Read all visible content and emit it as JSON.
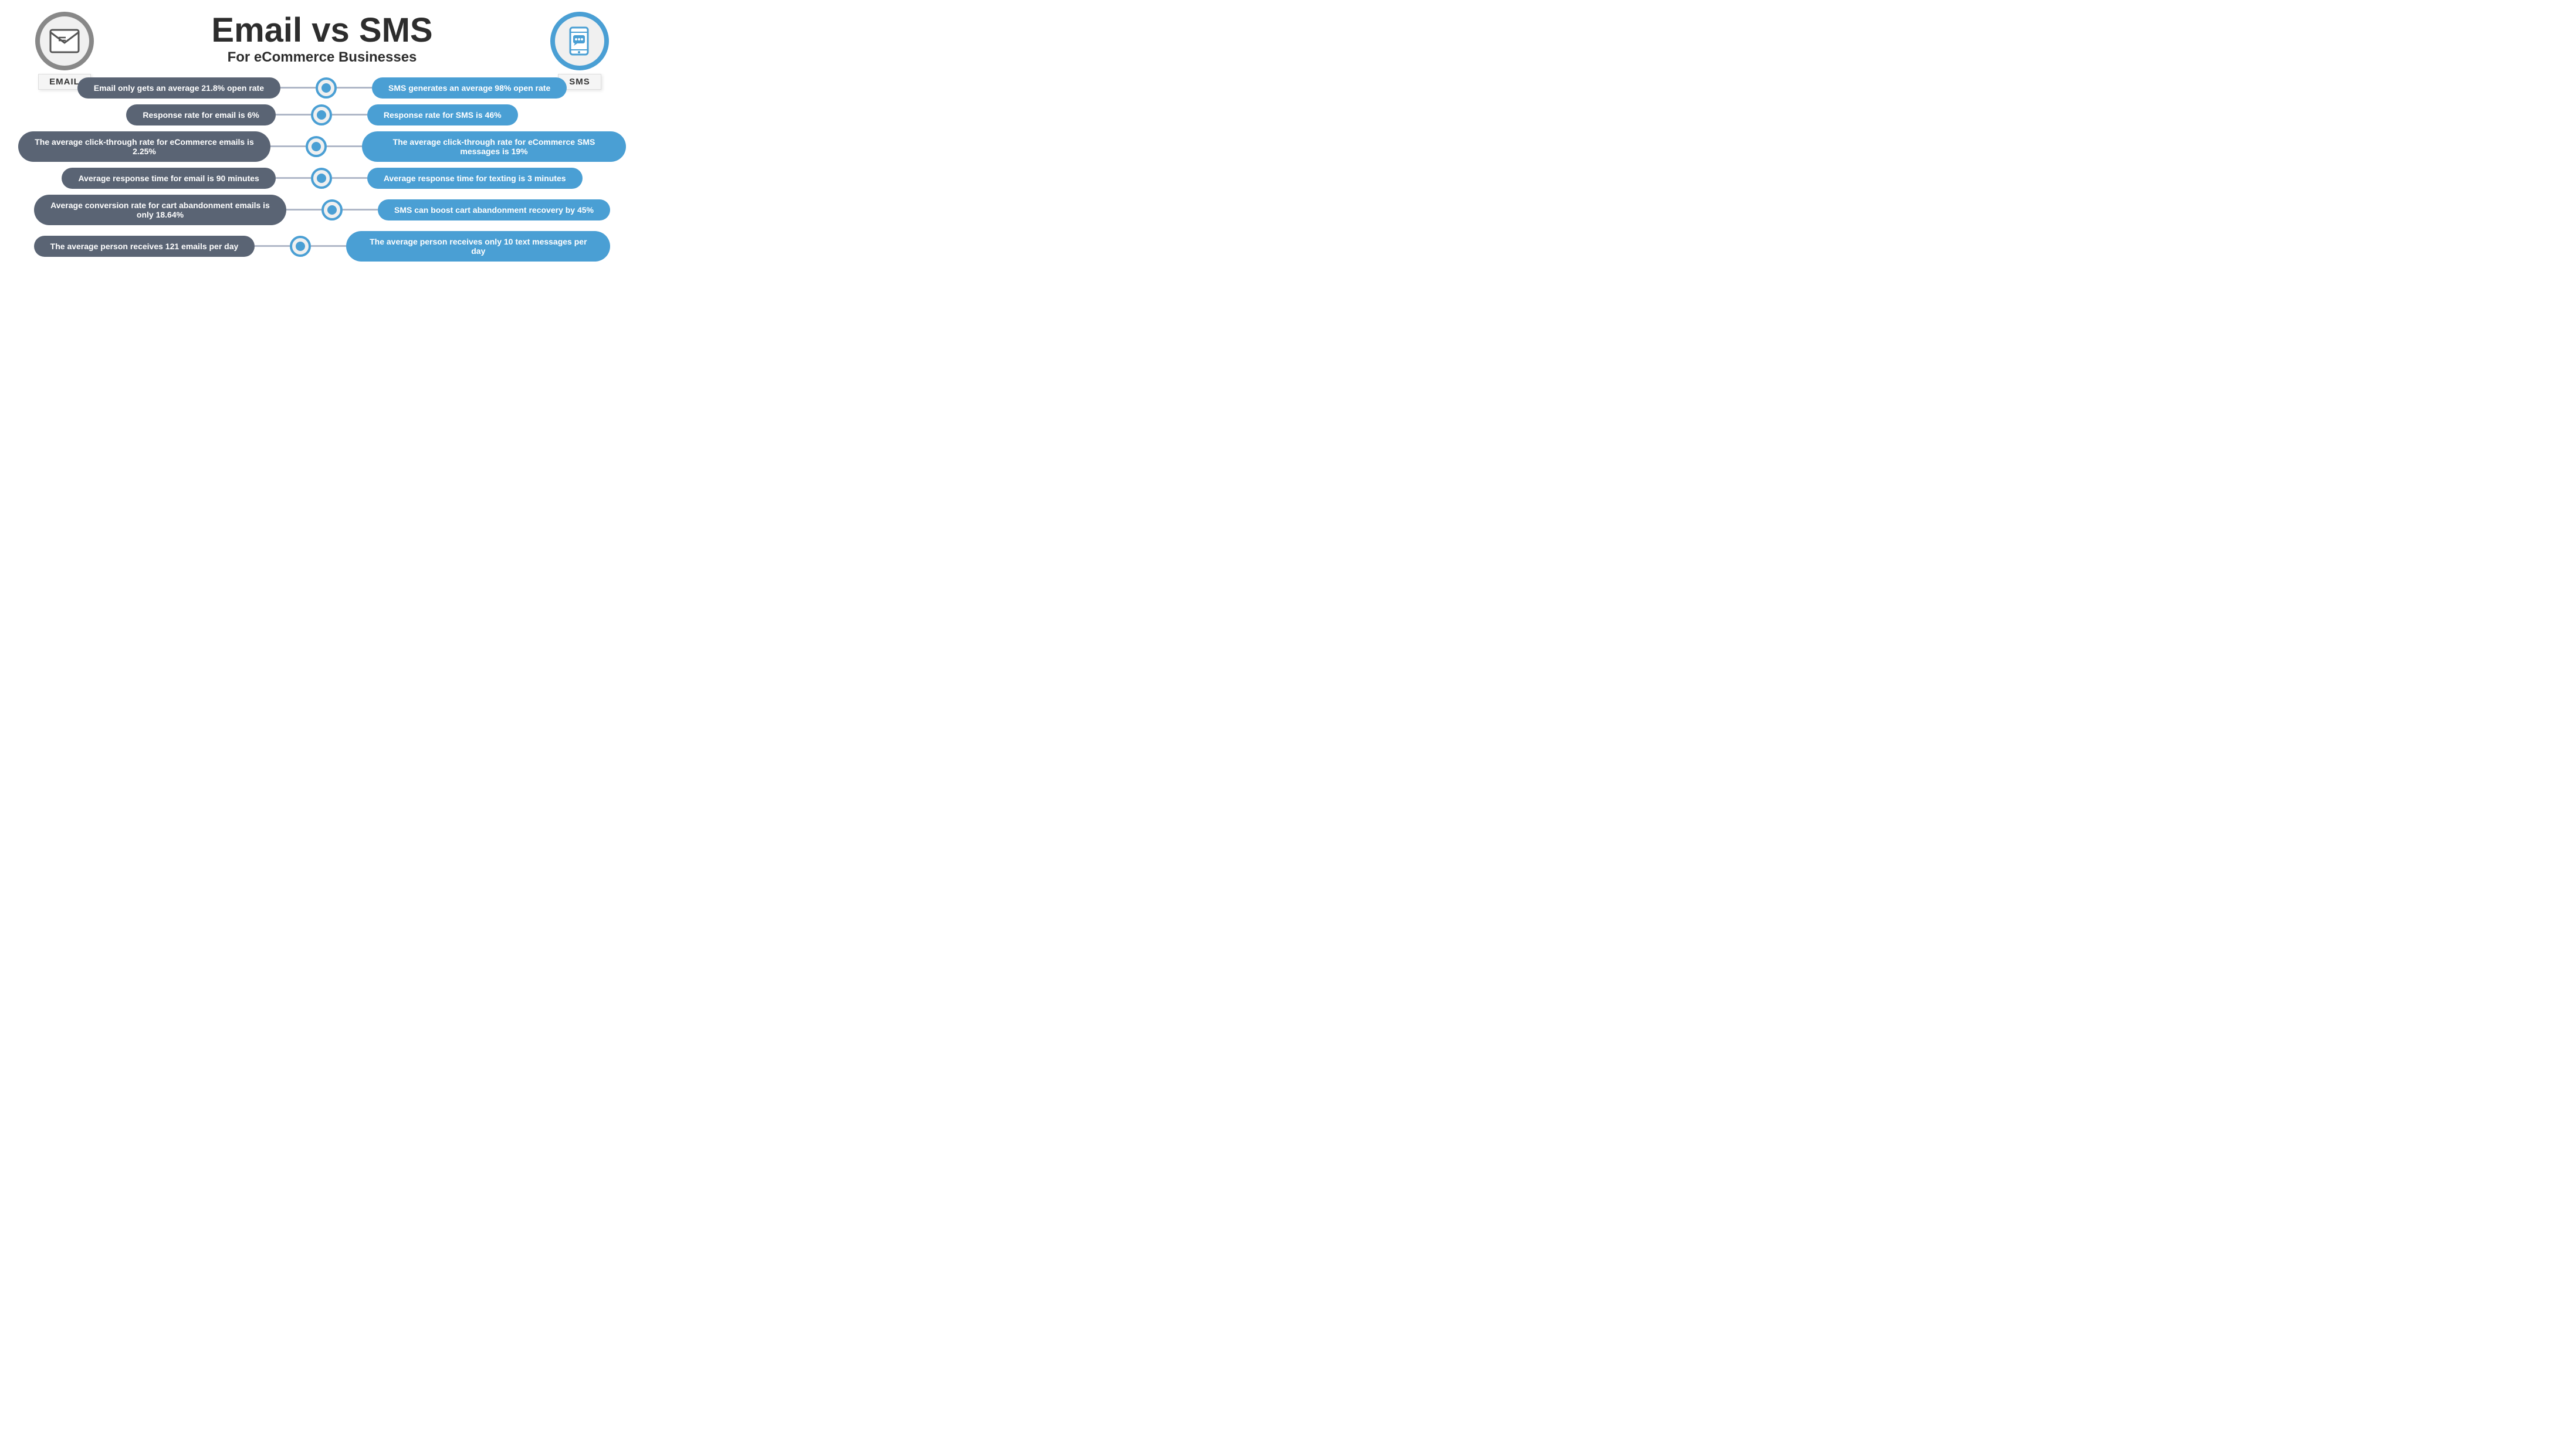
{
  "header": {
    "title": "Email vs SMS",
    "subtitle": "For eCommerce Businesses",
    "left_label": "EMAIL",
    "right_label": "SMS"
  },
  "rows": [
    {
      "email": "Email only gets an average 21.8% open rate",
      "sms": "SMS generates an average 98% open rate"
    },
    {
      "email": "Response rate for email is 6%",
      "sms": "Response rate for SMS is 46%"
    },
    {
      "email": "The average click-through rate for eCommerce emails is 2.25%",
      "sms": "The average click-through rate for eCommerce SMS messages is 19%"
    },
    {
      "email": "Average response time for email is 90 minutes",
      "sms": "Average response time for texting is 3 minutes"
    },
    {
      "email": "Average conversion rate for cart abandonment emails is only 18.64%",
      "sms": "SMS can boost cart abandonment recovery by 45%"
    },
    {
      "email": "The average person receives 121 emails per day",
      "sms": "The average person receives only 10 text messages per day"
    }
  ]
}
